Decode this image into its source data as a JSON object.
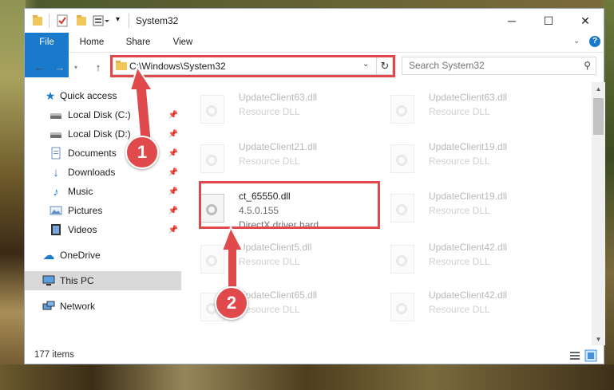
{
  "window": {
    "title": "System32",
    "controls": {
      "minimize": "─",
      "maximize": "☐",
      "close": "✕"
    }
  },
  "ribbon": {
    "tabs": [
      "File",
      "Home",
      "Share",
      "View"
    ]
  },
  "address": {
    "path": "C:\\Windows\\System32"
  },
  "search": {
    "placeholder": "Search System32"
  },
  "nav": {
    "quick_access": "Quick access",
    "items": [
      {
        "label": "Local Disk (C:)",
        "icon": "drive-icon"
      },
      {
        "label": "Local Disk (D:)",
        "icon": "drive-icon"
      },
      {
        "label": "Documents",
        "icon": "documents-icon"
      },
      {
        "label": "Downloads",
        "icon": "downloads-icon"
      },
      {
        "label": "Music",
        "icon": "music-icon"
      },
      {
        "label": "Pictures",
        "icon": "pictures-icon"
      },
      {
        "label": "Videos",
        "icon": "videos-icon"
      }
    ],
    "onedrive": "OneDrive",
    "this_pc": "This PC",
    "network": "Network"
  },
  "files": {
    "left": [
      {
        "name": "UpdateClient63.dll",
        "type": "Resource DLL"
      },
      {
        "name": "UpdateClient21.dll",
        "type": "Resource DLL"
      },
      {
        "name": "ct_65550.dll",
        "version": "4.5.0.155",
        "description": "DirectX driver hard..."
      },
      {
        "name": "UpdateClient5.dll",
        "type": "Resource DLL"
      },
      {
        "name": "UpdateClient65.dll",
        "type": "Resource DLL"
      }
    ],
    "right": [
      {
        "name": "UpdateClient63.dll",
        "type": "Resource DLL"
      },
      {
        "name": "UpdateClient19.dll",
        "type": "Resource DLL"
      },
      {
        "name": "UpdateClient19.dll",
        "type": "Resource DLL"
      },
      {
        "name": "UpdateClient42.dll",
        "type": "Resource DLL"
      },
      {
        "name": "UpdateClient42.dll",
        "type": "Resource DLL"
      }
    ]
  },
  "status": {
    "count": "177 items"
  },
  "callouts": [
    "1",
    "2"
  ],
  "colors": {
    "accent": "#1979ca",
    "highlight": "#e2474b"
  }
}
